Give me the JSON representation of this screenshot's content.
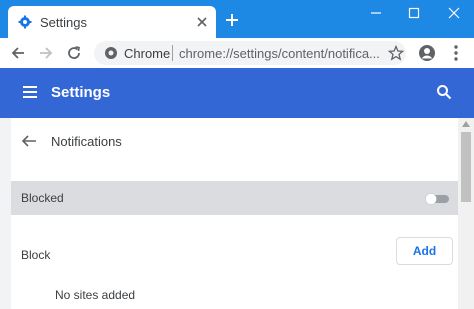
{
  "tab": {
    "title": "Settings",
    "icon": "settings-gear-icon"
  },
  "omnibox": {
    "scheme_label": "Chrome",
    "url": "chrome://settings/content/notifica..."
  },
  "header": {
    "title": "Settings"
  },
  "page": {
    "title": "Notifications"
  },
  "blocked_row": {
    "label": "Blocked",
    "toggle_state": "off"
  },
  "block_section": {
    "label": "Block",
    "add_label": "Add",
    "empty_text": "No sites added"
  },
  "colors": {
    "titlebar": "#1e88e5",
    "header": "#3367d6",
    "accent": "#1a73e8",
    "row_highlight": "#dadce0"
  }
}
